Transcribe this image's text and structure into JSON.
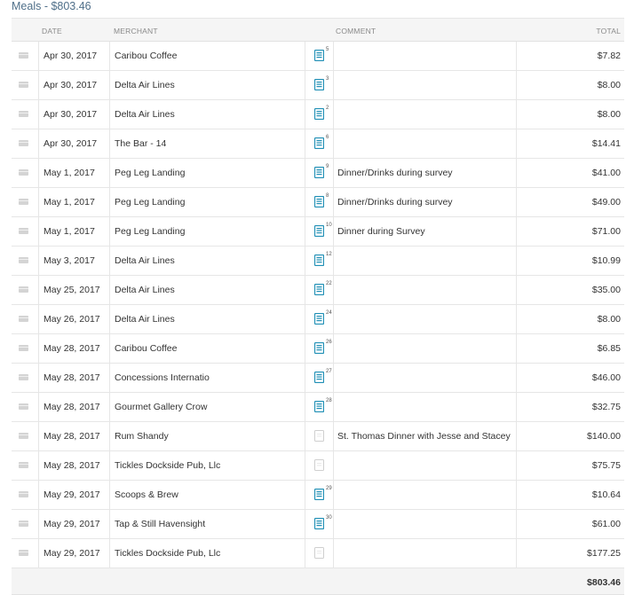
{
  "section": {
    "title": "Meals - $803.46"
  },
  "columns": {
    "date": "DATE",
    "merchant": "MERCHANT",
    "comment": "COMMENT",
    "total": "TOTAL"
  },
  "rows": [
    {
      "date": "Apr 30, 2017",
      "merchant": "Caribou Coffee",
      "receipt": "5",
      "has_receipt": true,
      "comment": "",
      "total": "$7.82"
    },
    {
      "date": "Apr 30, 2017",
      "merchant": "Delta Air Lines",
      "receipt": "3",
      "has_receipt": true,
      "comment": "",
      "total": "$8.00"
    },
    {
      "date": "Apr 30, 2017",
      "merchant": "Delta Air Lines",
      "receipt": "2",
      "has_receipt": true,
      "comment": "",
      "total": "$8.00"
    },
    {
      "date": "Apr 30, 2017",
      "merchant": "The Bar - 14",
      "receipt": "6",
      "has_receipt": true,
      "comment": "",
      "total": "$14.41"
    },
    {
      "date": "May 1, 2017",
      "merchant": "Peg Leg Landing",
      "receipt": "9",
      "has_receipt": true,
      "comment": "Dinner/Drinks during survey",
      "total": "$41.00"
    },
    {
      "date": "May 1, 2017",
      "merchant": "Peg Leg Landing",
      "receipt": "8",
      "has_receipt": true,
      "comment": "Dinner/Drinks during survey",
      "total": "$49.00"
    },
    {
      "date": "May 1, 2017",
      "merchant": "Peg Leg Landing",
      "receipt": "10",
      "has_receipt": true,
      "comment": "Dinner during Survey",
      "total": "$71.00"
    },
    {
      "date": "May 3, 2017",
      "merchant": "Delta Air Lines",
      "receipt": "12",
      "has_receipt": true,
      "comment": "",
      "total": "$10.99"
    },
    {
      "date": "May 25, 2017",
      "merchant": "Delta Air Lines",
      "receipt": "22",
      "has_receipt": true,
      "comment": "",
      "total": "$35.00"
    },
    {
      "date": "May 26, 2017",
      "merchant": "Delta Air Lines",
      "receipt": "24",
      "has_receipt": true,
      "comment": "",
      "total": "$8.00"
    },
    {
      "date": "May 28, 2017",
      "merchant": "Caribou Coffee",
      "receipt": "26",
      "has_receipt": true,
      "comment": "",
      "total": "$6.85"
    },
    {
      "date": "May 28, 2017",
      "merchant": "Concessions Internatio",
      "receipt": "27",
      "has_receipt": true,
      "comment": "",
      "total": "$46.00"
    },
    {
      "date": "May 28, 2017",
      "merchant": "Gourmet Gallery Crow",
      "receipt": "28",
      "has_receipt": true,
      "comment": "",
      "total": "$32.75"
    },
    {
      "date": "May 28, 2017",
      "merchant": "Rum Shandy",
      "receipt": "",
      "has_receipt": false,
      "comment": "St. Thomas Dinner with Jesse and Stacey",
      "total": "$140.00"
    },
    {
      "date": "May 28, 2017",
      "merchant": "Tickles Dockside Pub, Llc",
      "receipt": "",
      "has_receipt": false,
      "comment": "",
      "total": "$75.75"
    },
    {
      "date": "May 29, 2017",
      "merchant": "Scoops & Brew",
      "receipt": "29",
      "has_receipt": true,
      "comment": "",
      "total": "$10.64"
    },
    {
      "date": "May 29, 2017",
      "merchant": "Tap & Still Havensight",
      "receipt": "30",
      "has_receipt": true,
      "comment": "",
      "total": "$61.00"
    },
    {
      "date": "May 29, 2017",
      "merchant": "Tickles Dockside Pub, Llc",
      "receipt": "",
      "has_receipt": false,
      "comment": "",
      "total": "$177.25"
    }
  ],
  "footer": {
    "total": "$803.46"
  },
  "colors": {
    "title": "#4f6f89",
    "receipt_icon": "#1f8fb5",
    "receipt_empty": "#cccccc"
  },
  "icons": {
    "row_select": "checkbox-icon",
    "receipt": "receipt-icon",
    "receipt_missing": "receipt-empty-icon"
  }
}
